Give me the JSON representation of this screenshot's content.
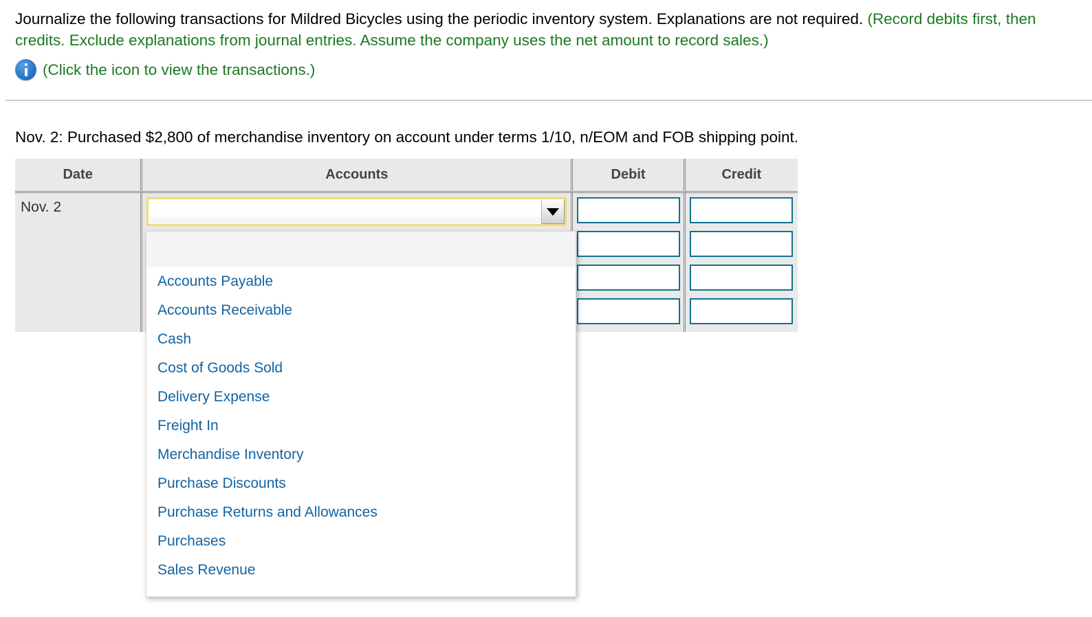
{
  "problem": {
    "line1_black": "Journalize the following transactions for Mildred Bicycles using the periodic inventory system. Explanations are not required. ",
    "line1_green": "(Record debits first, then credits. Exclude explanations from journal entries. Assume the company uses the net amount to record sales.)",
    "icon_name": "info-icon",
    "icon_caption": "(Click the icon to view the transactions.)"
  },
  "transaction": {
    "description": "Nov. 2: Purchased $2,800 of merchandise inventory on account under terms 1/10, n/EOM and FOB shipping point."
  },
  "journal": {
    "headers": {
      "date": "Date",
      "accounts": "Accounts",
      "debit": "Debit",
      "credit": "Credit"
    },
    "row": {
      "date": "Nov. 2",
      "selected_account": "",
      "debit_values": [
        "",
        "",
        "",
        ""
      ],
      "credit_values": [
        "",
        "",
        "",
        ""
      ]
    }
  },
  "accounts_dropdown": {
    "expanded": true,
    "options": [
      "",
      "Accounts Payable",
      "Accounts Receivable",
      "Cash",
      "Cost of Goods Sold",
      "Delivery Expense",
      "Freight In",
      "Merchandise Inventory",
      "Purchase Discounts",
      "Purchase Returns and Allowances",
      "Purchases",
      "Sales Revenue"
    ]
  },
  "colors": {
    "green_instruction": "#1a7a20",
    "option_link_blue": "#1264a3",
    "input_border_teal": "#10728f",
    "focus_border_gold": "#f4d97a",
    "header_bg_gray": "#e9e9e9"
  }
}
